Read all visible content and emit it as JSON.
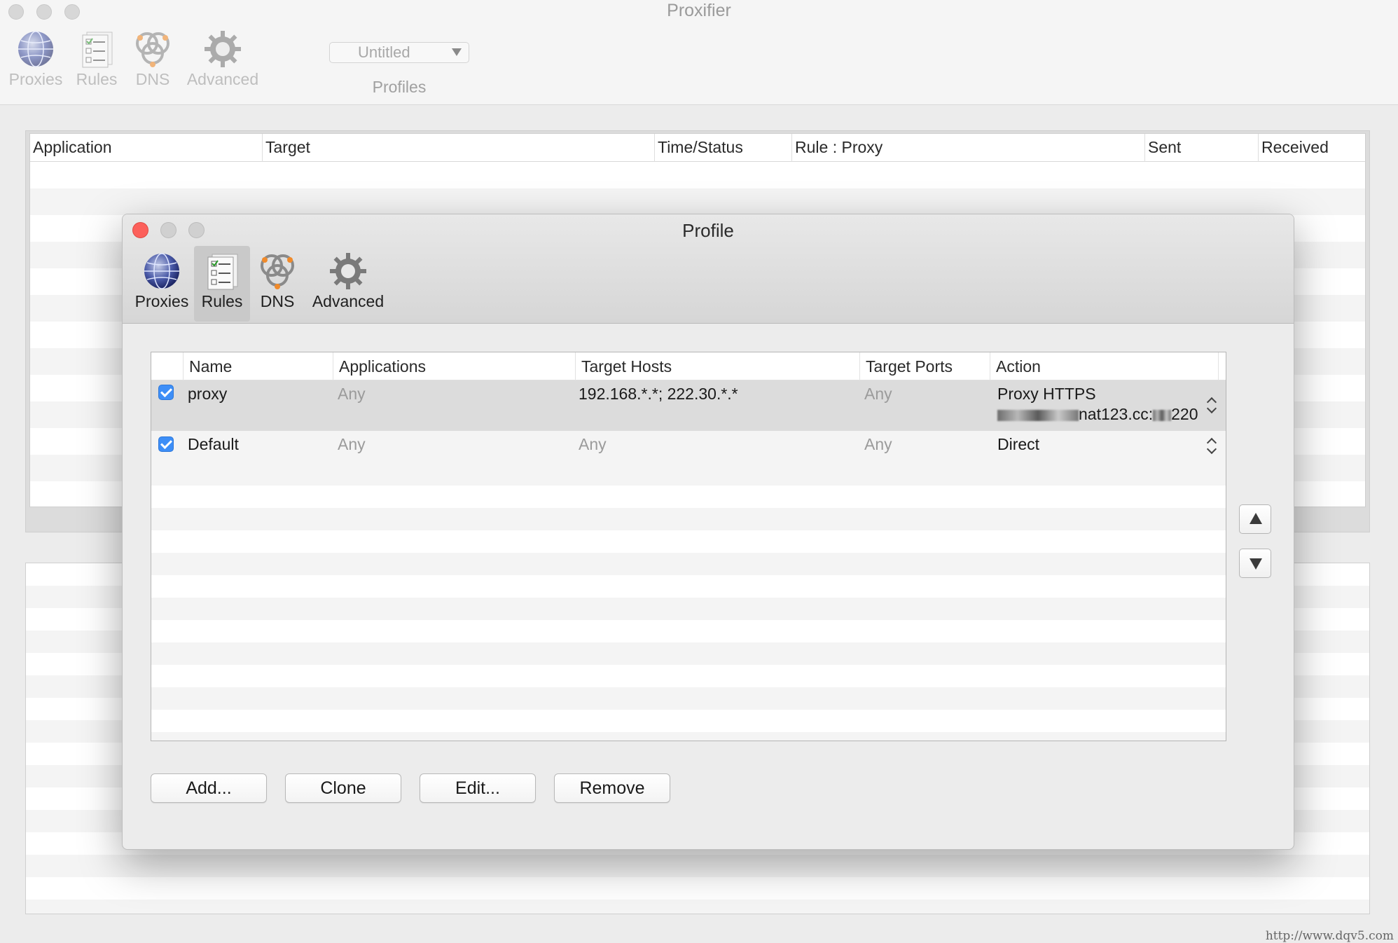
{
  "main_window": {
    "title": "Proxifier",
    "toolbar": [
      {
        "label": "Proxies",
        "icon": "globe-icon"
      },
      {
        "label": "Rules",
        "icon": "rules-icon"
      },
      {
        "label": "DNS",
        "icon": "dns-icon"
      },
      {
        "label": "Advanced",
        "icon": "gear-icon"
      }
    ],
    "profile_select": {
      "value": "Untitled",
      "label": "Profiles"
    },
    "connections_table": {
      "columns": [
        "Application",
        "Target",
        "Time/Status",
        "Rule : Proxy",
        "Sent",
        "Received"
      ]
    }
  },
  "profile_sheet": {
    "title": "Profile",
    "toolbar": [
      {
        "label": "Proxies",
        "icon": "globe-icon",
        "selected": false
      },
      {
        "label": "Rules",
        "icon": "rules-icon",
        "selected": true
      },
      {
        "label": "DNS",
        "icon": "dns-icon",
        "selected": false
      },
      {
        "label": "Advanced",
        "icon": "gear-icon",
        "selected": false
      }
    ],
    "rules_table": {
      "columns": [
        "Name",
        "Applications",
        "Target Hosts",
        "Target Ports",
        "Action"
      ],
      "rows": [
        {
          "enabled": true,
          "name": "proxy",
          "applications": "Any",
          "target_hosts": "192.168.*.*; 222.30.*.*",
          "target_ports": "Any",
          "action_line1": "Proxy HTTPS",
          "action_line2": "nat123.cc:",
          "action_line2_suffix": "220"
        },
        {
          "enabled": true,
          "name": "Default",
          "applications": "Any",
          "target_hosts": "Any",
          "target_ports": "Any",
          "action_line1": "Direct"
        }
      ]
    },
    "buttons": {
      "add": "Add...",
      "clone": "Clone",
      "edit": "Edit...",
      "remove": "Remove"
    }
  },
  "watermark": "http://www.dqv5.com",
  "colors": {
    "checkbox": "#3d8ef7",
    "close_button": "#fc605b",
    "selected_tab": "#c9c9c9"
  }
}
